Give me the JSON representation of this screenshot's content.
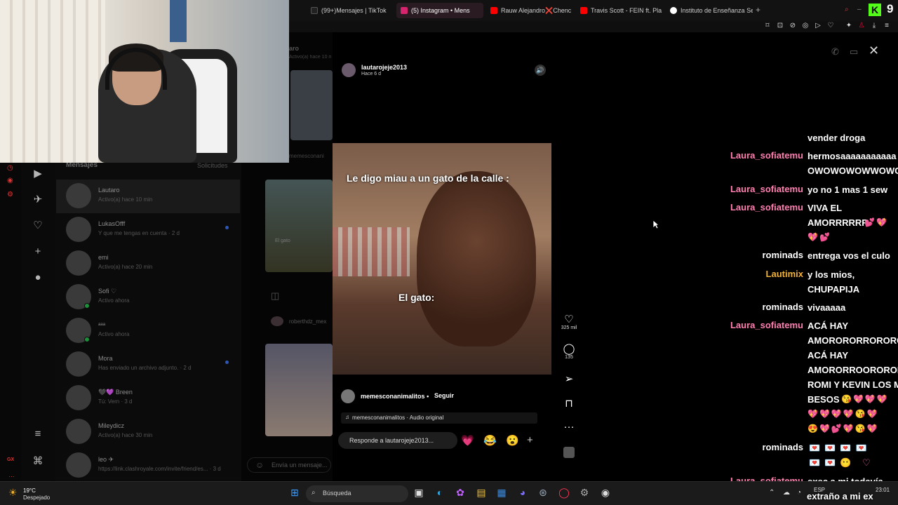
{
  "browser": {
    "tabs": [
      {
        "label": "(99+)Mensajes | TikTok",
        "icon": "tiktok-icon",
        "color": "#222222"
      },
      {
        "label": "(5) Instagram • Mens",
        "icon": "instagram-icon",
        "color": "#d6246e",
        "active": true
      },
      {
        "label": "Rauw Alejandro❌Chenc",
        "icon": "youtube-icon",
        "color": "#ff0000"
      },
      {
        "label": "Travis Scott - FEIN ft. Pla",
        "icon": "youtube-icon",
        "color": "#ff0000"
      },
      {
        "label": "Instituto de Enseñanza Se",
        "icon": "google-icon",
        "color": "#4285f4"
      }
    ],
    "new_tab": "+"
  },
  "story": {
    "username": "lautarojeje2013",
    "time": "Hace 6 d",
    "caption_top": "Le digo miau a un gato de la calle :",
    "caption_mid": "El gato:",
    "post_user": "memesconanimalitos",
    "post_dot": "•",
    "follow": "Seguir",
    "audio": "memesconanimalitos · Audio original",
    "reply_placeholder": "Responde a lautarojeje2013...",
    "likes": "325 mil",
    "comments": "135",
    "reactions": [
      "💗",
      "😂",
      "😮"
    ],
    "add": "+"
  },
  "messages": {
    "title": "Mensajes",
    "requests": "Solicitudes",
    "conversations": [
      {
        "name": "Lautaro",
        "sub": "Activo(a) hace 10 min",
        "selected": true
      },
      {
        "name": "LukasOfff",
        "sub": "Y que me tengas en cuenta · 2 d",
        "unread": true
      },
      {
        "name": "emi",
        "sub": "Activo(a) hace 20 min"
      },
      {
        "name": "Sofi ♡",
        "sub": "Activo ahora",
        "online": true
      },
      {
        "name": "ᵃᵃᵃ",
        "sub": "Activo ahora",
        "online": true
      },
      {
        "name": "Mora",
        "sub": "Has enviado un archivo adjunto. · 2 d",
        "unread": true
      },
      {
        "name": "🖤💜 Breen",
        "sub": "Tú: Vern · 3 d"
      },
      {
        "name": "Mileydicz",
        "sub": "Activo(a) hace 30 min"
      },
      {
        "name": "leo ✈",
        "sub": "https://link.clashroyale.com/invite/friend/es... · 3 d"
      }
    ]
  },
  "chat_area": {
    "partner_short": "aro",
    "partner_status": "Activo(a) hace 10 min",
    "shared_label": "memesconani",
    "thumb_caption": "El gato",
    "reel_user": "roberthdz_mex",
    "input_placeholder": "Envía un mensaje..."
  },
  "stream_chat": [
    {
      "user": "",
      "text": "vender droga",
      "color": "#ffffff"
    },
    {
      "user": "Laura_sofiatemu",
      "text": "hermosaaaaaaaaaaa",
      "text2": "OWOWOWOWWOWO",
      "color": "#ff7fb0"
    },
    {
      "user": "Laura_sofiatemu",
      "text": "yo no 1 mas 1 sew",
      "color": "#ff7fb0"
    },
    {
      "user": "Laura_sofiatemu",
      "text": "VIVA EL",
      "text2": "AMORRRRRR",
      "color": "#ff7fb0"
    },
    {
      "user": "rominads",
      "text": "entrega vos el culo",
      "color": "#ffffff"
    },
    {
      "user": "Lautimix",
      "text": "y los mios,",
      "text2": "CHUPAPIJA",
      "color": "#f0b23a"
    },
    {
      "user": "rominads",
      "text": "vivaaaaa",
      "color": "#ffffff"
    },
    {
      "user": "Laura_sofiatemu",
      "text": "ACÁ HAY",
      "text2": "AMORORORRORORC",
      "text3": "ACÁ HAY",
      "text4": "AMORORROOROROR",
      "text5": "ROMI Y KEVIN LOS M",
      "text6": "BESOS",
      "color": "#ff7fb0"
    },
    {
      "user": "rominads",
      "text": "",
      "color": "#ffffff"
    },
    {
      "user": "Laura_sofiatemu",
      "text": "exec a mi todavía",
      "color": "#ff7fb0"
    }
  ],
  "watermark": "extraño a mi ex",
  "kick": {
    "logo": "K",
    "viewers": "9"
  },
  "taskbar": {
    "weather_temp": "19°C",
    "weather_desc": "Despejado",
    "search": "Búsqueda",
    "lang": "ESP",
    "time": "23:01",
    "gx": "GX"
  }
}
